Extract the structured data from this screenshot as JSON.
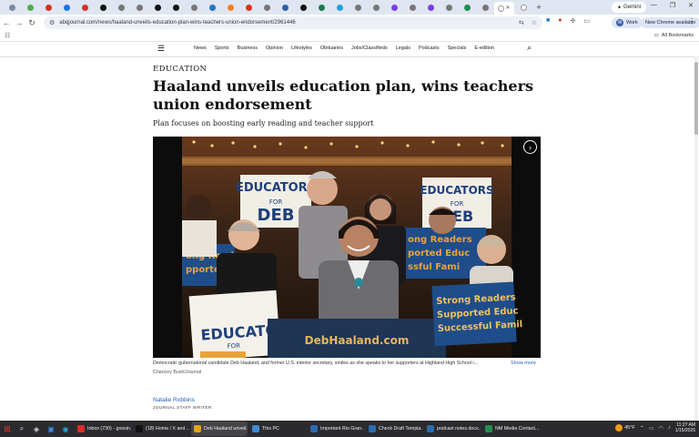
{
  "browser": {
    "tabs": [
      {
        "icon": "site-favicon",
        "color": "#7a8aa8"
      },
      {
        "icon": "chrome-favicon",
        "color": "#4caf50"
      },
      {
        "icon": "gmail-favicon",
        "color": "#d93025"
      },
      {
        "icon": "outlook-favicon",
        "color": "#1a73e8"
      },
      {
        "icon": "stack-favicon",
        "color": "#d93025"
      },
      {
        "icon": "x-favicon",
        "color": "#111111"
      },
      {
        "icon": "site-favicon",
        "color": "#777777"
      },
      {
        "icon": "site-favicon",
        "color": "#777777"
      },
      {
        "icon": "x-favicon",
        "color": "#111111"
      },
      {
        "icon": "e-favicon",
        "color": "#111111"
      },
      {
        "icon": "site-favicon",
        "color": "#777777"
      },
      {
        "icon": "bird-favicon",
        "color": "#2a73c5"
      },
      {
        "icon": "orange-favicon",
        "color": "#f48024"
      },
      {
        "icon": "red-favicon",
        "color": "#e0321f"
      },
      {
        "icon": "site-favicon",
        "color": "#777777"
      },
      {
        "icon": "site-favicon",
        "color": "#2f5fa8"
      },
      {
        "icon": "x-favicon",
        "color": "#111111"
      },
      {
        "icon": "site-favicon",
        "color": "#1d7a4c"
      },
      {
        "icon": "site-favicon",
        "color": "#26a0da"
      },
      {
        "icon": "site-favicon",
        "color": "#777777"
      },
      {
        "icon": "site-favicon",
        "color": "#777777"
      },
      {
        "icon": "purple-favicon",
        "color": "#7b3fe4"
      },
      {
        "icon": "site-favicon",
        "color": "#777777"
      },
      {
        "icon": "purple-favicon",
        "color": "#7b3fe4"
      },
      {
        "icon": "site-favicon",
        "color": "#777777"
      },
      {
        "icon": "green-favicon",
        "color": "#1f8f4e"
      },
      {
        "icon": "site-favicon",
        "color": "#777777"
      },
      {
        "icon": "active-tab-favicon",
        "color": "#ffffff",
        "active": true
      },
      {
        "icon": "blank-favicon",
        "color": "#ffffff"
      }
    ],
    "new_tab_glyph": "+",
    "gemini_label": "Gemini",
    "url": "abqjournal.com/news/haaland-unveils-education-plan-wins-teachers-union-endorsement/2961446",
    "profile_initial": "W",
    "profile_label": "Work",
    "update_label": "New Chrome available",
    "all_bookmarks_label": "All Bookmarks"
  },
  "site": {
    "nav": [
      "News",
      "Sports",
      "Business",
      "Opinion",
      "Lifestyles",
      "Obituaries",
      "Jobs/Classifieds",
      "Legals",
      "Podcasts",
      "Specials",
      "E-edition"
    ]
  },
  "article": {
    "section": "EDUCATION",
    "headline": "Haaland unveils education plan, wins teachers union endorsement",
    "subhead": "Plan focuses on boosting early reading and teacher support",
    "caption": "Democratic gubernatorial candidate Deb Haaland, and former U.S. interior secretary, smiles as she speaks to her supporters at Highland High School i...",
    "show_more": "Show more",
    "credit": "Chancey Bush/Journal",
    "author": "Natalie Robbins",
    "author_role": "JOURNAL STAFF WRITER"
  },
  "photo": {
    "signs": {
      "educators_top": "EDUCATORS",
      "for": "FOR",
      "deb": "DEB",
      "podium": "DebHaaland.com",
      "strong_readers": "Strong Readers",
      "supported_educ": "Supported Educ",
      "successful_fam": "Successful Famil",
      "left_sign_partial": "EDUCATO",
      "left_for": "FOR",
      "left_deb": "DEB",
      "back_left_a": "ong Reade",
      "back_left_b": "pported",
      "back_right_a": "ong Readers",
      "back_right_b": "ported Educ",
      "back_right_c": "ssful Fami"
    }
  },
  "taskbar": {
    "apps": [
      {
        "label": "Inbox (730) - gossin...",
        "color": "#d93025",
        "active": false
      },
      {
        "label": "(18) Home / X and ...",
        "color": "#111111",
        "active": false
      },
      {
        "label": "Deb Haaland unveil...",
        "color": "#e6a21a",
        "active": true
      },
      {
        "label": "This PC",
        "color": "#3c8ad8",
        "active": false
      },
      {
        "label": "Important Rio Gran...",
        "color": "#2b6cb0",
        "active": false
      },
      {
        "label": "Check Draft Templa...",
        "color": "#2b6cb0",
        "active": false
      },
      {
        "label": "podcast notes.docx...",
        "color": "#2b6cb0",
        "active": false
      },
      {
        "label": "NM Media Contact...",
        "color": "#1f8f4e",
        "active": false
      }
    ],
    "temperature": "45°F",
    "time": "11:27 AM",
    "date": "1/15/2026"
  }
}
